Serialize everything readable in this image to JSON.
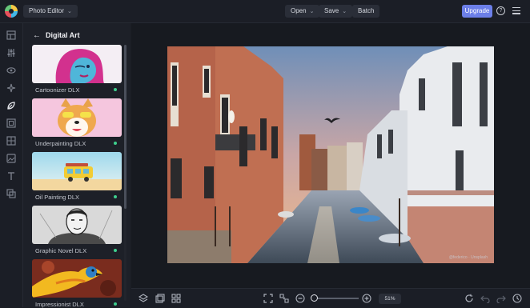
{
  "topbar": {
    "app_menu": "Photo Editor",
    "open": "Open",
    "save": "Save",
    "batch": "Batch",
    "upgrade": "Upgrade",
    "help_glyph": "?",
    "accent_color": "#6c7fe8"
  },
  "rail": {
    "items": [
      "layout-icon",
      "sliders-icon",
      "eye-icon",
      "sparkle-icon",
      "effects-icon",
      "frame-icon",
      "texture-icon",
      "overlay-icon",
      "text-icon",
      "graphics-icon"
    ],
    "active": "effects-icon"
  },
  "panel": {
    "title": "Digital Art",
    "back_glyph": "←",
    "items": [
      {
        "label": "Cartoonizer DLX"
      },
      {
        "label": "Underpainting DLX"
      },
      {
        "label": "Oil Painting DLX"
      },
      {
        "label": "Graphic Novel DLX"
      },
      {
        "label": "Impressionist DLX"
      }
    ],
    "status_color": "#3ecf8e"
  },
  "canvas": {
    "watermark": "@federico · Unsplash"
  },
  "bottombar": {
    "zoom_value": "51%",
    "minus_glyph": "−",
    "plus_glyph": "+"
  }
}
